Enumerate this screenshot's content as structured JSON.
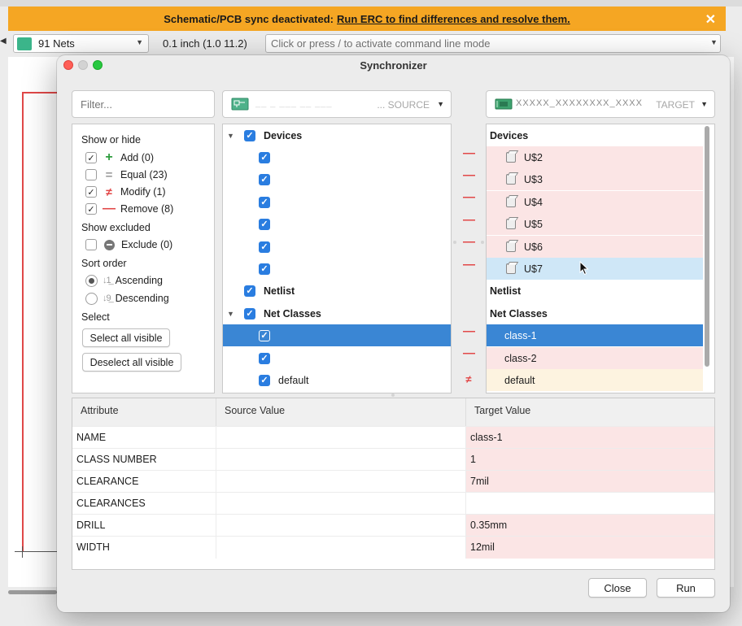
{
  "banner": {
    "message": "Schematic/PCB sync deactivated:",
    "link": "Run ERC to find differences and resolve them.",
    "close_glyph": "✕",
    "color": "#f5a623"
  },
  "toolbar": {
    "nets_label": "91 Nets",
    "grid_readout": "0.1 inch (1.0 11.2)",
    "command_placeholder": "Click or press / to activate command line mode"
  },
  "dialog": {
    "title": "Synchronizer",
    "filter_placeholder": "Filter...",
    "source": {
      "tag": "... SOURCE",
      "name": "__ _ ___ __ ___"
    },
    "target": {
      "tag": "TARGET",
      "name": "XXXXX_XXXXXXXX_XXXX"
    },
    "options": {
      "show_hide_heading": "Show or hide",
      "add": "Add (0)",
      "equal": "Equal (23)",
      "modify": "Modify (1)",
      "remove": "Remove (8)",
      "show_excluded_heading": "Show excluded",
      "exclude": "Exclude (0)",
      "sort_heading": "Sort order",
      "ascending": "Ascending",
      "descending": "Descending",
      "select_heading": "Select",
      "select_all": "Select all visible",
      "deselect_all": "Deselect all visible"
    },
    "source_tree": {
      "devices": "Devices",
      "netlist": "Netlist",
      "net_classes": "Net Classes",
      "default_class": "default"
    },
    "target_tree": {
      "devices": "Devices",
      "device_items": [
        "U$2",
        "U$3",
        "U$4",
        "U$5",
        "U$6",
        "U$7"
      ],
      "netlist": "Netlist",
      "net_classes": "Net Classes",
      "class_items": [
        "class-1",
        "class-2",
        "default"
      ]
    },
    "attributes": {
      "headers": [
        "Attribute",
        "Source Value",
        "Target Value"
      ],
      "rows": [
        {
          "attr": "NAME",
          "source": "",
          "target": "class-1"
        },
        {
          "attr": "CLASS NUMBER",
          "source": "",
          "target": "1"
        },
        {
          "attr": "CLEARANCE",
          "source": "",
          "target": "7mil"
        },
        {
          "attr": "CLEARANCES",
          "source": "",
          "target": ""
        },
        {
          "attr": "DRILL",
          "source": "",
          "target": "0.35mm"
        },
        {
          "attr": "WIDTH",
          "source": "",
          "target": "12mil"
        }
      ]
    },
    "buttons": {
      "close": "Close",
      "run": "Run"
    }
  },
  "colors": {
    "remove_row": "#fbe5e5",
    "modify_row": "#fdf3e0",
    "selection": "#3a86d4",
    "checkbox": "#2a7de0"
  }
}
